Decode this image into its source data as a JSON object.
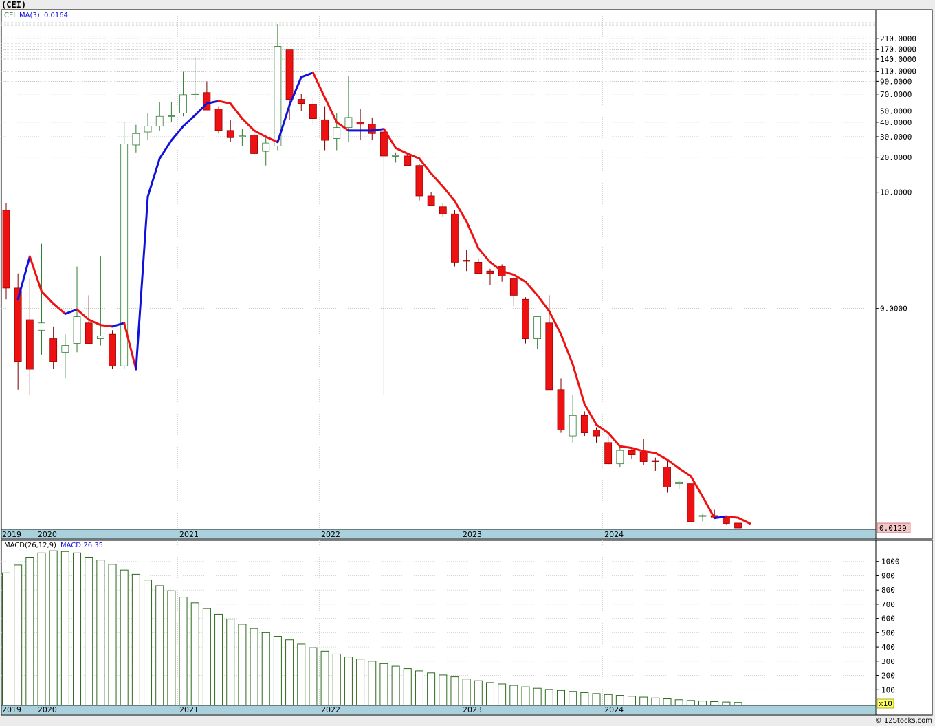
{
  "title": "(CEI)",
  "credit": "© 12Stocks.com",
  "colors": {
    "up": "#2e7d32",
    "down": "#ee1111",
    "ma_up": "#1111dd",
    "ma_down": "#ee1111",
    "macd": "#2e6b1e",
    "axis_band": "#a9d0db",
    "price_tag": "#f3c7c7"
  },
  "chart_data": [
    {
      "type": "candlestick",
      "title": "(CEI)",
      "legend": {
        "symbol": "CEI",
        "ma_label": "MA(3)",
        "ma_value": "0.0164"
      },
      "scale": "log",
      "ylim": [
        0.0129,
        300
      ],
      "ytick_labels": [
        "210.0000",
        "170.0000",
        "140.0000",
        "110.0000",
        "90.0000",
        "70.0000",
        "50.0000",
        "40.0000",
        "30.0000",
        "20.0000",
        "10.0000",
        "0.0000"
      ],
      "yticks": [
        210,
        170,
        140,
        110,
        90,
        70,
        50,
        40,
        30,
        20,
        10,
        1
      ],
      "last_price_label": "0.0129",
      "year_labels": [
        "2019",
        "2020",
        "2021",
        "2022",
        "2023",
        "2024"
      ],
      "year_start_index": [
        0,
        3,
        15,
        27,
        39,
        51
      ],
      "months": [
        "2019-10",
        "2019-11",
        "2019-12",
        "2020-01",
        "2020-02",
        "2020-03",
        "2020-04",
        "2020-05",
        "2020-06",
        "2020-07",
        "2020-08",
        "2020-09",
        "2020-10",
        "2020-11",
        "2020-12",
        "2021-01",
        "2021-02",
        "2021-03",
        "2021-04",
        "2021-05",
        "2021-06",
        "2021-07",
        "2021-08",
        "2021-09",
        "2021-10",
        "2021-11",
        "2021-12",
        "2022-01",
        "2022-02",
        "2022-03",
        "2022-04",
        "2022-05",
        "2022-06",
        "2022-07",
        "2022-08",
        "2022-09",
        "2022-10",
        "2022-11",
        "2022-12",
        "2023-01",
        "2023-02",
        "2023-03",
        "2023-04",
        "2023-05",
        "2023-06",
        "2023-07",
        "2023-08",
        "2023-09",
        "2023-10",
        "2023-11",
        "2023-12",
        "2024-01",
        "2024-02",
        "2024-03",
        "2024-04",
        "2024-05",
        "2024-06",
        "2024-07",
        "2024-08",
        "2024-09",
        "2024-10",
        "2024-11",
        "2024-12",
        "2025-01"
      ],
      "ohlc": [
        [
          7.0,
          8.0,
          1.2,
          1.5
        ],
        [
          1.5,
          2.0,
          0.2,
          0.35
        ],
        [
          0.8,
          1.8,
          0.18,
          0.3
        ],
        [
          0.65,
          3.6,
          0.4,
          0.75
        ],
        [
          0.55,
          0.7,
          0.3,
          0.35
        ],
        [
          0.42,
          0.6,
          0.25,
          0.48
        ],
        [
          0.5,
          2.3,
          0.42,
          0.85
        ],
        [
          0.75,
          1.3,
          0.5,
          0.5
        ],
        [
          0.55,
          2.8,
          0.48,
          0.58
        ],
        [
          0.6,
          0.65,
          0.3,
          0.32
        ],
        [
          0.32,
          40,
          0.3,
          26.0
        ],
        [
          25.5,
          38,
          22,
          32.0
        ],
        [
          33,
          48,
          28,
          37.0
        ],
        [
          37,
          60,
          34,
          45.0
        ],
        [
          45,
          60,
          40,
          45.5
        ],
        [
          48,
          110,
          45,
          69.0
        ],
        [
          70,
          145,
          62,
          70.5
        ],
        [
          72,
          90,
          54,
          51.0
        ],
        [
          52,
          55,
          32,
          34.0
        ],
        [
          34,
          42,
          27,
          29.5
        ],
        [
          30,
          35,
          25,
          30.5
        ],
        [
          31,
          37,
          21,
          21.5
        ],
        [
          22.5,
          31,
          17,
          26.5
        ],
        [
          25,
          280,
          23,
          180
        ],
        [
          170,
          165,
          42,
          63
        ],
        [
          63,
          70,
          50,
          58
        ],
        [
          57,
          65,
          38,
          43
        ],
        [
          42,
          55,
          23,
          28
        ],
        [
          29,
          48,
          23,
          36
        ],
        [
          36,
          100,
          27,
          44
        ],
        [
          40,
          52,
          28,
          38.5
        ],
        [
          38.5,
          44,
          28,
          32.0
        ],
        [
          33,
          35,
          0.18,
          20.5
        ],
        [
          20.5,
          22,
          18,
          20.7
        ],
        [
          20.5,
          21,
          18.5,
          17.0
        ],
        [
          17,
          17.5,
          8.5,
          9.3
        ],
        [
          9.3,
          10,
          7.7,
          7.7
        ],
        [
          7.5,
          8,
          6.1,
          6.5
        ],
        [
          6.5,
          7,
          2.3,
          2.5
        ],
        [
          2.6,
          3.2,
          2.1,
          2.55
        ],
        [
          2.5,
          2.7,
          2.1,
          2.0
        ],
        [
          2.1,
          2.2,
          1.6,
          2.0
        ],
        [
          2.3,
          2.4,
          1.7,
          1.9
        ],
        [
          1.8,
          1.85,
          1.05,
          1.3
        ],
        [
          1.2,
          1.25,
          0.5,
          0.55
        ],
        [
          0.55,
          0.85,
          0.45,
          0.85
        ],
        [
          0.75,
          1.3,
          0.2,
          0.2
        ],
        [
          0.2,
          0.25,
          0.085,
          0.09
        ],
        [
          0.08,
          0.18,
          0.07,
          0.12
        ],
        [
          0.12,
          0.13,
          0.08,
          0.085
        ],
        [
          0.09,
          0.095,
          0.07,
          0.08
        ],
        [
          0.07,
          0.08,
          0.045,
          0.046
        ],
        [
          0.046,
          0.065,
          0.043,
          0.06
        ],
        [
          0.06,
          0.064,
          0.051,
          0.055
        ],
        [
          0.058,
          0.075,
          0.045,
          0.048
        ],
        [
          0.049,
          0.052,
          0.04,
          0.048
        ],
        [
          0.043,
          0.051,
          0.026,
          0.029
        ],
        [
          0.031,
          0.033,
          0.028,
          0.032
        ],
        [
          0.031,
          0.031,
          0.0144,
          0.0146
        ],
        [
          0.0165,
          0.017,
          0.0147,
          0.0165
        ],
        [
          0.0165,
          0.0185,
          0.0155,
          0.016
        ],
        [
          0.0163,
          0.0165,
          0.0139,
          0.0141
        ],
        [
          0.0142,
          0.0142,
          0.0124,
          0.0129
        ]
      ],
      "ma3": [
        1.2,
        2.8,
        1.4,
        1.1,
        0.9,
        0.98,
        0.8,
        0.72,
        0.7,
        0.75,
        0.3,
        9.2,
        19.5,
        28,
        37,
        46,
        58,
        61,
        58,
        43,
        34,
        30,
        27,
        56,
        98,
        107,
        65,
        40,
        34,
        34,
        34,
        35,
        24,
        21.5,
        19.5,
        14.5,
        11.2,
        8.4,
        5.6,
        3.3,
        2.5,
        2.1,
        1.95,
        1.7,
        1.3,
        0.95,
        0.6,
        0.33,
        0.15,
        0.1,
        0.085,
        0.065,
        0.063,
        0.059,
        0.057,
        0.05,
        0.042,
        0.036,
        0.024,
        0.0157,
        0.0162,
        0.0158,
        0.0141
      ]
    },
    {
      "type": "bar",
      "title": "MACD(26,12,9)",
      "legend": {
        "label": "MACD(26,12,9)",
        "value_label": "MACD:26.35"
      },
      "scale_note": "x10",
      "ylim": [
        0,
        1100
      ],
      "ytick_labels": [
        "1000",
        "900",
        "800",
        "700",
        "600",
        "500",
        "400",
        "300",
        "200",
        "100"
      ],
      "yticks": [
        1000,
        900,
        800,
        700,
        600,
        500,
        400,
        300,
        200,
        100
      ],
      "values": [
        920,
        975,
        1030,
        1060,
        1075,
        1070,
        1060,
        1030,
        1010,
        980,
        940,
        910,
        870,
        830,
        795,
        750,
        710,
        670,
        630,
        595,
        560,
        530,
        500,
        475,
        450,
        420,
        395,
        370,
        350,
        330,
        315,
        300,
        283,
        265,
        248,
        232,
        218,
        203,
        190,
        175,
        163,
        150,
        140,
        130,
        120,
        110,
        102,
        95,
        88,
        80,
        73,
        66,
        60,
        54,
        48,
        42,
        36,
        30,
        25,
        21,
        17,
        14,
        11
      ]
    }
  ]
}
